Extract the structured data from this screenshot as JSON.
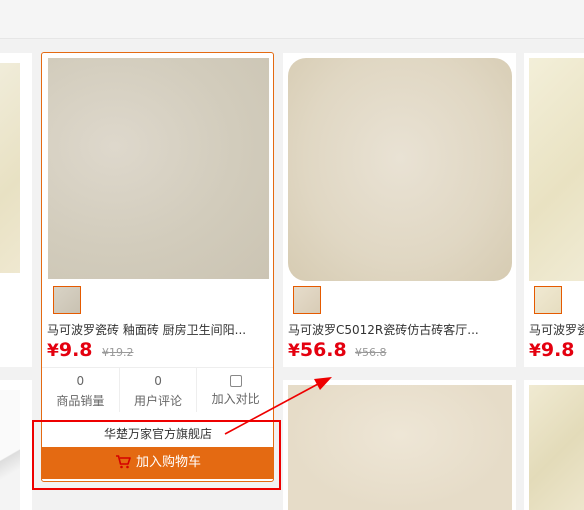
{
  "colors": {
    "accent": "#e46a12",
    "price": "#e4000f",
    "annotation": "#e00000"
  },
  "products": [
    {
      "title": "马可波罗瓷砖 釉面砖 厨房卫生间阳...",
      "currency": "¥",
      "price": "9.8",
      "old_price": "¥19.2",
      "sales_count": "0",
      "sales_label": "商品销量",
      "review_count": "0",
      "review_label": "用户评论",
      "compare_label": "加入对比",
      "shop_name": "华楚万家官方旗舰店",
      "cart_label": "加入购物车",
      "cart_icon": "shopping-cart-icon"
    },
    {
      "title": "马可波罗C5012R瓷砖仿古砖客厅...",
      "currency": "¥",
      "price": "56.8",
      "old_price": "¥56.8"
    },
    {
      "title": "马可波罗瓷",
      "currency": "¥",
      "price": "9.8"
    }
  ]
}
